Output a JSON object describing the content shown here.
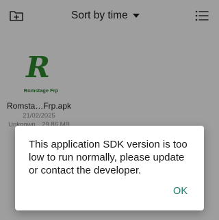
{
  "toolbar": {
    "sort_label": "Sort by time",
    "new_folder_icon": "folder-plus-icon",
    "sort_caret_icon": "caret-down-icon",
    "list_view_icon": "list-view-icon"
  },
  "files": [
    {
      "thumbnail_letter": "R",
      "thumbnail_text": "Romstage Frp",
      "name": "Romsta…Frp.apk",
      "date": "21/02/2025",
      "meta": "Unknown…29.86 MB"
    }
  ],
  "dialog": {
    "message": "This application SDK version is too low to run normally, please update or contact the developer.",
    "ok_label": "OK"
  },
  "colors": {
    "accent": "#1f7a6a",
    "logo_green": "#2e8b2e"
  }
}
